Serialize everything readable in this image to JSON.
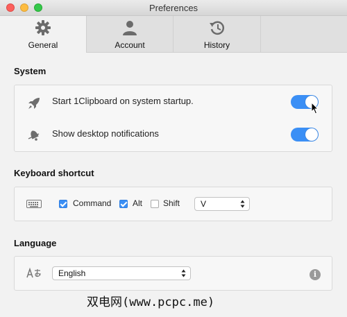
{
  "window": {
    "title": "Preferences"
  },
  "tabs": [
    {
      "label": "General",
      "icon": "gear-icon",
      "active": true
    },
    {
      "label": "Account",
      "icon": "user-icon",
      "active": false
    },
    {
      "label": "History",
      "icon": "history-icon",
      "active": false
    }
  ],
  "system": {
    "title": "System",
    "startup_label": "Start 1Clipboard on system startup.",
    "startup_enabled": true,
    "notifications_label": "Show desktop notifications",
    "notifications_enabled": true
  },
  "keyboard": {
    "title": "Keyboard shortcut",
    "command_label": "Command",
    "command_checked": true,
    "alt_label": "Alt",
    "alt_checked": true,
    "shift_label": "Shift",
    "shift_checked": false,
    "key_value": "V"
  },
  "language": {
    "title": "Language",
    "selected": "English"
  },
  "watermark": "双电网(www.pcpc.me)",
  "colors": {
    "accent": "#3b8ff5"
  }
}
